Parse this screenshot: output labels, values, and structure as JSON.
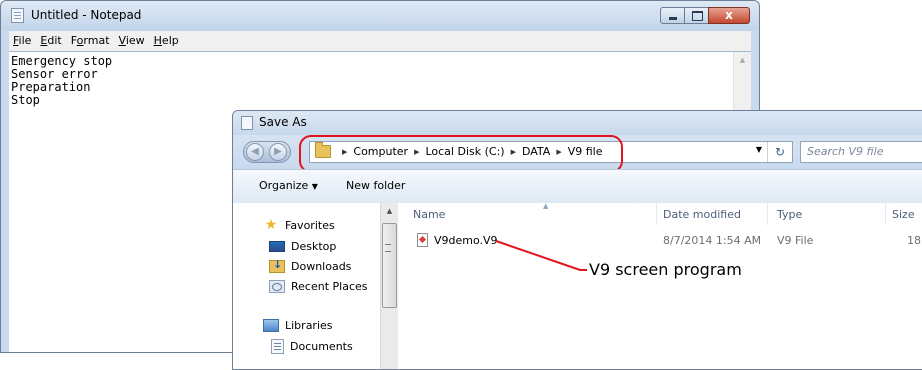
{
  "notepad": {
    "title": "Untitled - Notepad",
    "menu": [
      "File",
      "Edit",
      "Format",
      "View",
      "Help"
    ],
    "menu_accel": [
      "F",
      "E",
      "o",
      "V",
      "H"
    ],
    "text": "Emergency stop\nSensor error\nPreparation\nStop",
    "close_glyph": "x"
  },
  "save_as": {
    "title": "Save As",
    "breadcrumb": [
      "Computer",
      "Local Disk (C:)",
      "DATA",
      "V9 file"
    ],
    "search_placeholder": "Search V9 file",
    "toolbar": {
      "organize_label": "Organize",
      "organize_arrow": "▼",
      "new_folder_label": "New folder"
    },
    "nav": {
      "favorites": "Favorites",
      "desktop": "Desktop",
      "downloads": "Downloads",
      "recent_places": "Recent Places",
      "libraries": "Libraries",
      "documents": "Documents"
    },
    "columns": {
      "name": "Name",
      "date_modified": "Date modified",
      "type": "Type",
      "size": "Size"
    },
    "files": [
      {
        "name": "V9demo.V9",
        "date_modified": "8/7/2014 1:54 AM",
        "type": "V9 File",
        "size": "18,"
      }
    ]
  },
  "annotation": {
    "callout_text": "V9 screen program",
    "highlight_color": "#e3141b"
  }
}
